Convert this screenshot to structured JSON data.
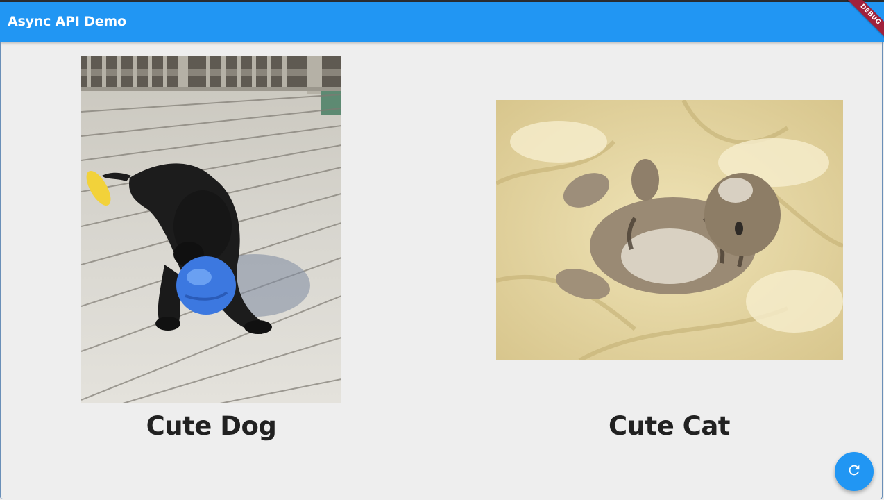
{
  "app_bar": {
    "title": "Async API Demo",
    "debug_banner": "DEBUG",
    "color": "#2196f3"
  },
  "cards": [
    {
      "caption": "Cute Dog",
      "image": "black-puppy-on-deck-with-blue-toy-photo"
    },
    {
      "caption": "Cute Cat",
      "image": "kitten-lying-on-back-in-blankets-photo"
    }
  ],
  "fab": {
    "icon": "refresh-icon",
    "color": "#2196f3"
  }
}
